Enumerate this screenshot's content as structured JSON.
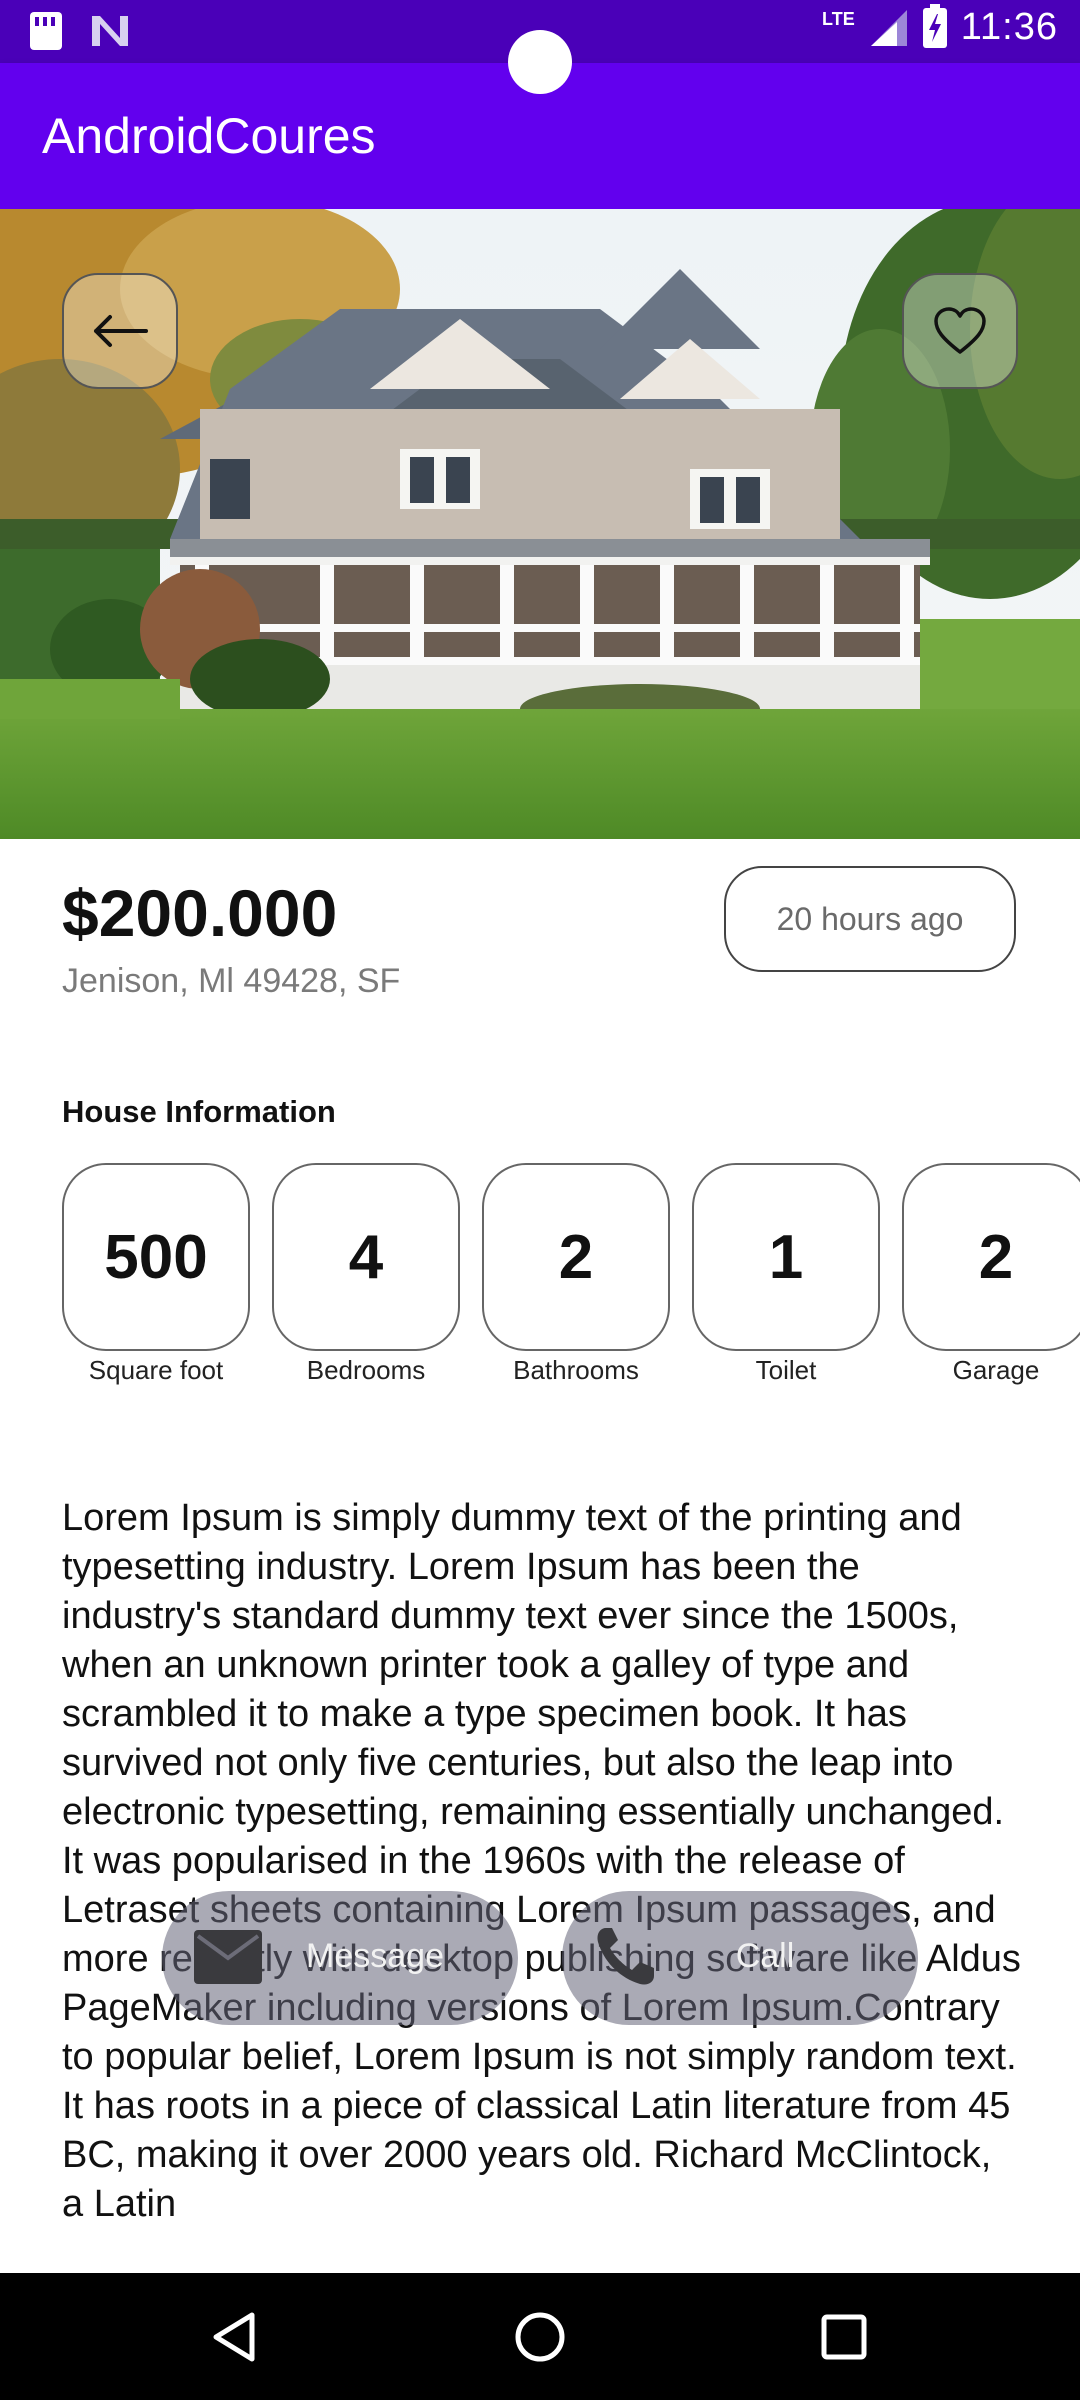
{
  "status_bar": {
    "time": "11:36",
    "network": "LTE",
    "icons": [
      "sd-card-icon",
      "n-icon",
      "lte-icon",
      "signal-icon",
      "battery-charging-icon"
    ]
  },
  "app_bar": {
    "title": "AndroidCoures"
  },
  "hero": {
    "back_icon": "arrow-left-icon",
    "favorite_icon": "heart-outline-icon"
  },
  "listing": {
    "price": "$200.000",
    "address": "Jenison, Ml 49428, SF",
    "posted": "20 hours ago"
  },
  "house_info": {
    "title": "House Information",
    "items": [
      {
        "value": "500",
        "label": "Square foot"
      },
      {
        "value": "4",
        "label": "Bedrooms"
      },
      {
        "value": "2",
        "label": "Bathrooms"
      },
      {
        "value": "1",
        "label": "Toilet"
      },
      {
        "value": "2",
        "label": "Garage"
      }
    ]
  },
  "description": "Lorem Ipsum is simply dummy text of the printing and typesetting industry. Lorem Ipsum has been the industry's standard dummy text ever since the 1500s, when an unknown printer took a galley of type and scrambled it to make a type specimen book. It has survived not only five centuries, but also the leap into electronic typesetting, remaining essentially unchanged. It was popularised in the 1960s with the release of Letraset sheets containing Lorem Ipsum passages, and more recently with desktop publishing software like Aldus PageMaker including versions of Lorem Ipsum.Contrary to popular belief, Lorem Ipsum is not simply random text. It has roots in a piece of classical Latin literature from 45 BC, making it over 2000 years old. Richard McClintock, a Latin",
  "actions": {
    "message_label": "Message",
    "call_label": "Call"
  },
  "colors": {
    "status_bar": "#4a00b8",
    "app_bar": "#6200ee",
    "nav_bar": "#000000"
  }
}
